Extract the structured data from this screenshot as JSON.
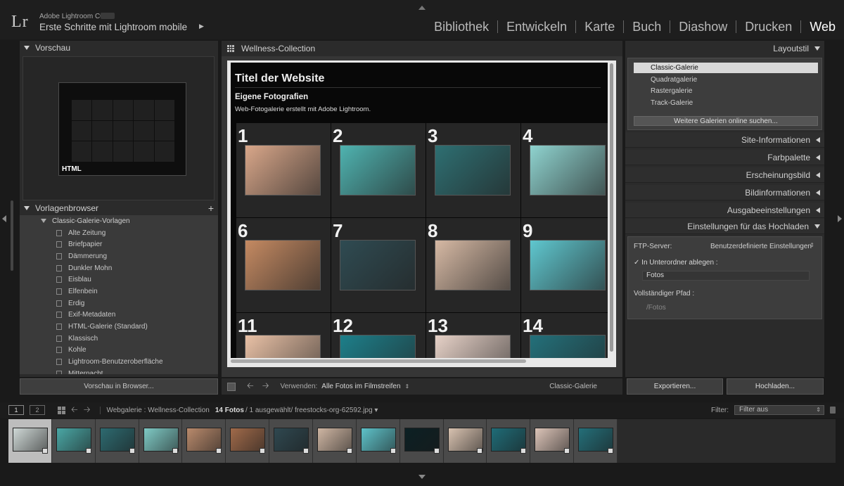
{
  "app": {
    "logo": "Lr",
    "name": "Adobe Lightroom CC",
    "catalog": "Erste Schritte mit Lightroom mobile"
  },
  "modules": [
    {
      "label": "Bibliothek",
      "active": false
    },
    {
      "label": "Entwickeln",
      "active": false
    },
    {
      "label": "Karte",
      "active": false
    },
    {
      "label": "Buch",
      "active": false
    },
    {
      "label": "Diashow",
      "active": false
    },
    {
      "label": "Drucken",
      "active": false
    },
    {
      "label": "Web",
      "active": true
    }
  ],
  "left": {
    "preview_title": "Vorschau",
    "preview_html_label": "HTML",
    "templates_title": "Vorlagenbrowser",
    "template_folder": "Classic-Galerie-Vorlagen",
    "templates": [
      "Alte Zeitung",
      "Briefpapier",
      "Dämmerung",
      "Dunkler Mohn",
      "Eisblau",
      "Elfenbein",
      "Erdig",
      "Exif-Metadaten",
      "HTML-Galerie (Standard)",
      "Klassisch",
      "Kohle",
      "Lightroom-Benutzeroberfläche",
      "Mitternacht"
    ],
    "preview_button": "Vorschau in Browser..."
  },
  "center": {
    "collection": "Wellness-Collection",
    "site_title": "Titel der Website",
    "site_subtitle": "Eigene Fotografien",
    "site_description": "Web-Fotogalerie erstellt mit Adobe Lightroom.",
    "thumbs": [
      {
        "num": "1",
        "color": "#d9a78a"
      },
      {
        "num": "2",
        "color": "#4fb3b0"
      },
      {
        "num": "3",
        "color": "#2e6f72"
      },
      {
        "num": "4",
        "color": "#8fd3cf"
      },
      {
        "num": "6",
        "color": "#c58a62"
      },
      {
        "num": "7",
        "color": "#2f4b52"
      },
      {
        "num": "8",
        "color": "#d6b9a4"
      },
      {
        "num": "9",
        "color": "#5fc7cf"
      },
      {
        "num": "11",
        "color": "#e9c1a6"
      },
      {
        "num": "12",
        "color": "#1d7f8a"
      },
      {
        "num": "13",
        "color": "#e7d2c8"
      },
      {
        "num": "14",
        "color": "#23707a"
      }
    ],
    "use_label": "Verwenden:",
    "use_value": "Alle Fotos im Filmstreifen",
    "gallery_label": "Classic-Galerie"
  },
  "right": {
    "layout_title": "Layoutstil",
    "layouts": [
      "Classic-Galerie",
      "Quadratgalerie",
      "Rastergalerie",
      "Track-Galerie"
    ],
    "selected_layout": "Classic-Galerie",
    "more_galleries": "Weitere Galerien online suchen...",
    "sections": [
      "Site-Informationen",
      "Farbpalette",
      "Erscheinungsbild",
      "Bildinformationen",
      "Ausgabeeinstellungen"
    ],
    "upload_title": "Einstellungen für das Hochladen",
    "ftp_label": "FTP-Server:",
    "ftp_value": "Benutzerdefinierte Einstellungen",
    "subfolder_label": "In Unterordner ablegen :",
    "subfolder_value": "Fotos",
    "full_path_label": "Vollständiger Pfad :",
    "full_path_value": "/Fotos",
    "export_button": "Exportieren...",
    "upload_button": "Hochladen..."
  },
  "filmbar": {
    "page1": "1",
    "page2": "2",
    "path": "Webgalerie : Wellness-Collection",
    "count": "14 Fotos",
    "selection": "/ 1 ausgewählt/ freestocks-org-62592.jpg ▾",
    "filter_label": "Filter:",
    "filter_value": "Filter aus"
  },
  "filmstrip": [
    {
      "color": "#cfd8d6",
      "selected": true
    },
    {
      "color": "#4aa7a5"
    },
    {
      "color": "#2d6a70"
    },
    {
      "color": "#7fcac5"
    },
    {
      "color": "#b98a6c"
    },
    {
      "color": "#a06a4a"
    },
    {
      "color": "#2f4850"
    },
    {
      "color": "#cfb6a3"
    },
    {
      "color": "#5ec2c9"
    },
    {
      "color": "#0c2024"
    },
    {
      "color": "#d8c2b0"
    },
    {
      "color": "#1f6c77"
    },
    {
      "color": "#dcc4b8"
    },
    {
      "color": "#246f79"
    }
  ]
}
